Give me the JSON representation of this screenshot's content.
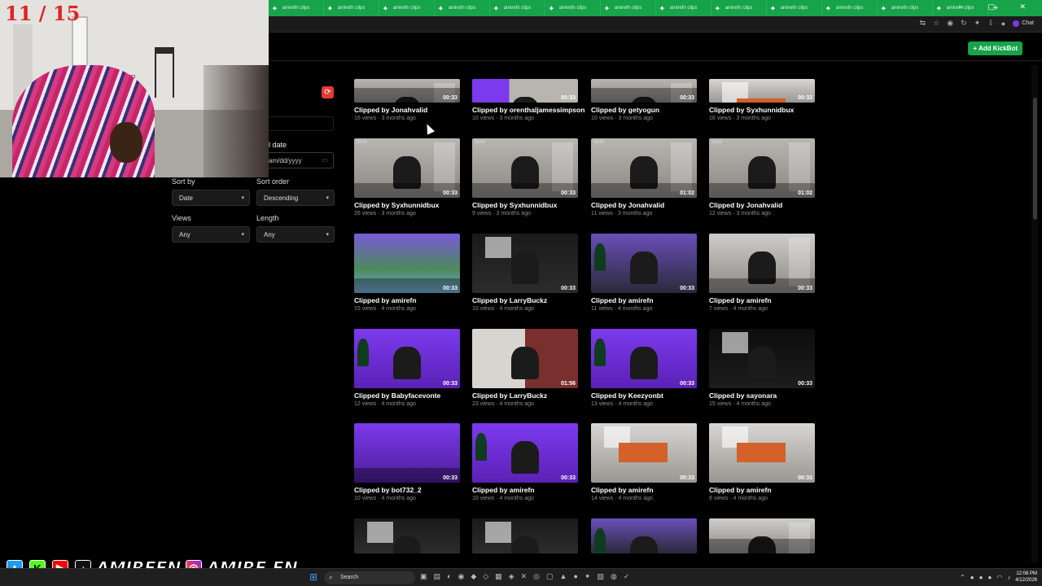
{
  "browser": {
    "tab_label": "amirefn clips",
    "tab_count": 13,
    "chat_label": "Chat"
  },
  "header": {
    "add_bot_label": "+ Add KickBot"
  },
  "filters": {
    "end_date_label": "l date",
    "date_placeholder": "am/dd/yyyy",
    "sort_by_label": "Sort by",
    "sort_by_value": "Date",
    "sort_order_label": "Sort order",
    "sort_order_value": "Descending",
    "views_label": "Views",
    "views_value": "Any",
    "length_label": "Length",
    "length_value": "Any"
  },
  "clips": [
    {
      "title": "Clipped by Jonahvalid",
      "meta": "16 views · 3 months ago",
      "duration": "00:33",
      "style": "room"
    },
    {
      "title": "Clipped by orenthaljamessimpson",
      "meta": "10 views · 3 months ago",
      "duration": "00:33",
      "style": "purple-room"
    },
    {
      "title": "Clipped by getyogun",
      "meta": "10 views · 3 months ago",
      "duration": "00:33",
      "style": "room"
    },
    {
      "title": "Clipped by Syxhunnidbux",
      "meta": "16 views · 3 months ago",
      "duration": "00:33",
      "style": "orange"
    },
    {
      "title": "Clipped by Syxhunnidbux",
      "meta": "26 views · 3 months ago",
      "duration": "00:33",
      "style": "room",
      "tag": "30/30"
    },
    {
      "title": "Clipped by Syxhunnidbux",
      "meta": "9 views · 3 months ago",
      "duration": "00:33",
      "style": "room",
      "tag": "30/30"
    },
    {
      "title": "Clipped by Jonahvalid",
      "meta": "11 views · 3 months ago",
      "duration": "01:02",
      "style": "room",
      "tag": "30/30"
    },
    {
      "title": "Clipped by Jonahvalid",
      "meta": "12 views · 3 months ago",
      "duration": "01:02",
      "style": "room",
      "tag": "30/30"
    },
    {
      "title": "Clipped by amirefn",
      "meta": "15 views · 4 months ago",
      "duration": "00:33",
      "style": "game"
    },
    {
      "title": "Clipped by LarryBuckz",
      "meta": "10 views · 4 months ago",
      "duration": "00:33",
      "style": "stream"
    },
    {
      "title": "Clipped by amirefn",
      "meta": "11 views · 4 months ago",
      "duration": "00:33",
      "style": "tree-room"
    },
    {
      "title": "Clipped by amirefn",
      "meta": "7 views · 4 months ago",
      "duration": "00:33",
      "style": "group"
    },
    {
      "title": "Clipped by Babyfacevonte",
      "meta": "12 views · 4 months ago",
      "duration": "00:33",
      "style": "purple"
    },
    {
      "title": "Clipped by LarryBuckz",
      "meta": "23 views · 4 months ago",
      "duration": "01:56",
      "style": "dance"
    },
    {
      "title": "Clipped by Keezyonbt",
      "meta": "13 views · 4 months ago",
      "duration": "00:33",
      "style": "purple"
    },
    {
      "title": "Clipped by sayonara",
      "meta": "15 views · 4 months ago",
      "duration": "00:33",
      "style": "dark-stream"
    },
    {
      "title": "Clipped by bot732_2",
      "meta": "10 views · 4 months ago",
      "duration": "00:33",
      "style": "purple-game"
    },
    {
      "title": "Clipped by amirefn",
      "meta": "10 views · 4 months ago",
      "duration": "00:33",
      "style": "purple"
    },
    {
      "title": "Clipped by amirefn",
      "meta": "14 views · 4 months ago",
      "duration": "00:33",
      "style": "orange"
    },
    {
      "title": "Clipped by amirefn",
      "meta": "8 views · 4 months ago",
      "duration": "00:33",
      "style": "orange"
    },
    {
      "title": "",
      "meta": "",
      "duration": "",
      "style": "stream"
    },
    {
      "title": "",
      "meta": "",
      "duration": "",
      "style": "stream"
    },
    {
      "title": "",
      "meta": "",
      "duration": "",
      "style": "tree-room"
    },
    {
      "title": "",
      "meta": "",
      "duration": "",
      "style": "group"
    }
  ],
  "overlay": {
    "counter": "11 / 15",
    "social_handle_1": "AMIREFN",
    "social_handle_2": "AMIRE.FN"
  },
  "taskbar": {
    "search_placeholder": "Search",
    "time": "12:08 PM",
    "date": "4/12/2026"
  },
  "colors": {
    "brand_green": "#16a34a",
    "kick_purple": "#7c3aed",
    "counter_red": "#e02424"
  }
}
